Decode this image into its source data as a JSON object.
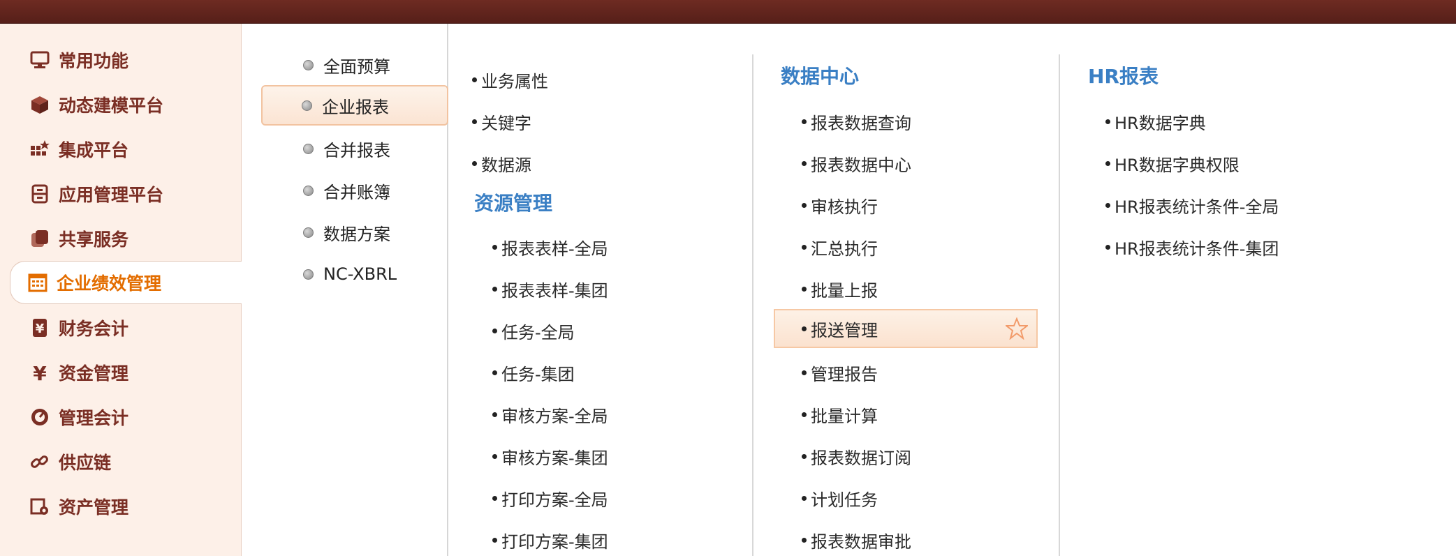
{
  "sidebar": {
    "items": [
      {
        "label": "常用功能",
        "icon": "monitor-icon"
      },
      {
        "label": "动态建模平台",
        "icon": "cube-icon"
      },
      {
        "label": "集成平台",
        "icon": "grid-icon"
      },
      {
        "label": "应用管理平台",
        "icon": "cabinet-icon"
      },
      {
        "label": "共享服务",
        "icon": "share-icon"
      },
      {
        "label": "企业绩效管理",
        "icon": "calendar-icon",
        "active": true
      },
      {
        "label": "财务会计",
        "icon": "yen-book-icon"
      },
      {
        "label": "资金管理",
        "icon": "yen-icon"
      },
      {
        "label": "管理会计",
        "icon": "gauge-icon"
      },
      {
        "label": "供应链",
        "icon": "link-icon"
      },
      {
        "label": "资产管理",
        "icon": "gear-doc-icon"
      }
    ]
  },
  "categories": {
    "items": [
      {
        "label": "全面预算"
      },
      {
        "label": "企业报表",
        "active": true
      },
      {
        "label": "合并报表"
      },
      {
        "label": "合并账簿"
      },
      {
        "label": "数据方案"
      },
      {
        "label": "NC-XBRL"
      }
    ]
  },
  "col1": {
    "items": [
      "业务属性",
      "关键字",
      "数据源"
    ],
    "group_title": "资源管理",
    "group_items": [
      "报表表样-全局",
      "报表表样-集团",
      "任务-全局",
      "任务-集团",
      "审核方案-全局",
      "审核方案-集团",
      "打印方案-全局",
      "打印方案-集团"
    ]
  },
  "col2": {
    "group_title": "数据中心",
    "group_items": [
      "报表数据查询",
      "报表数据中心",
      "审核执行",
      "汇总执行",
      "批量上报",
      "报送管理",
      "管理报告",
      "批量计算",
      "报表数据订阅",
      "计划任务",
      "报表数据审批"
    ],
    "highlight_index": 5
  },
  "col3": {
    "group_title": "HR报表",
    "group_items": [
      "HR数据字典",
      "HR数据字典权限",
      "HR报表统计条件-全局",
      "HR报表统计条件-集团"
    ]
  },
  "colors": {
    "topbar": "#5e231c",
    "sidebar_text": "#7a2e24",
    "active_text": "#e36d00",
    "group_title": "#3a7fc4",
    "highlight_border": "#f6c8a4"
  }
}
